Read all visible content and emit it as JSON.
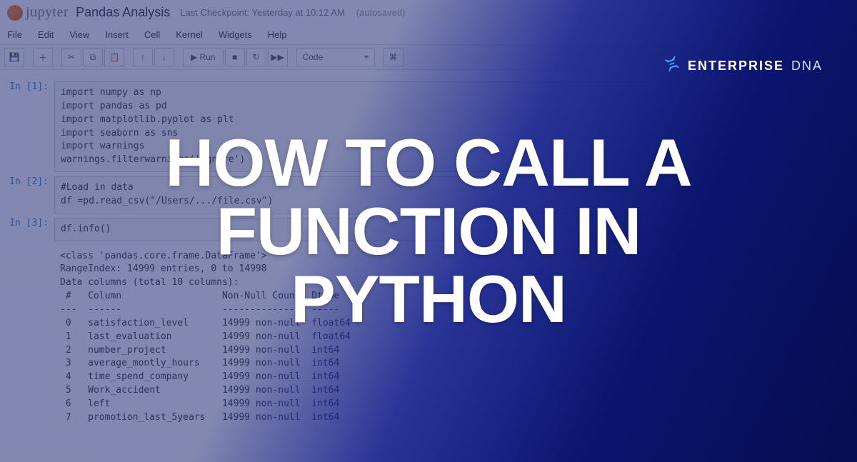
{
  "header": {
    "logo_text": "jupyter",
    "notebook_title": "Pandas Analysis",
    "checkpoint": "Last Checkpoint: Yesterday at 10:12 AM",
    "autosaved": "(autosaved)"
  },
  "menubar": [
    "File",
    "Edit",
    "View",
    "Insert",
    "Cell",
    "Kernel",
    "Widgets",
    "Help"
  ],
  "toolbar": {
    "save_icon": "💾",
    "add_icon": "＋",
    "cut_icon": "✂",
    "copy_icon": "⧉",
    "paste_icon": "📋",
    "up_icon": "↑",
    "down_icon": "↓",
    "run_label": "▶ Run",
    "stop_icon": "■",
    "restart_icon": "↻",
    "ff_icon": "▶▶",
    "celltype": "Code",
    "cmd_icon": "⌘"
  },
  "cells": {
    "in1_prompt": "In [1]:",
    "in1_code": "import numpy as np\nimport pandas as pd\nimport matplotlib.pyplot as plt\nimport seaborn as sns\nimport warnings\nwarnings.filterwarnings('ignore')",
    "in2_prompt": "In [2]:",
    "in2_code": "#Load in data\ndf =pd.read_csv(\"/Users/.../file.csv\")",
    "in3_prompt": "In [3]:",
    "in3_code": "df.info()",
    "out3": "<class 'pandas.core.frame.DataFrame'>\nRangeIndex: 14999 entries, 0 to 14998\nData columns (total 10 columns):\n #   Column                  Non-Null Count  Dtype  \n---  ------                  --------------  -----  \n 0   satisfaction_level      14999 non-null  float64\n 1   last_evaluation         14999 non-null  float64\n 2   number_project          14999 non-null  int64  \n 3   average_montly_hours    14999 non-null  int64  \n 4   time_spend_company      14999 non-null  int64  \n 5   Work_accident           14999 non-null  int64  \n 6   left                    14999 non-null  int64  \n 7   promotion_last_5years   14999 non-null  int64  "
  },
  "overlay": {
    "headline": "HOW TO CALL A\nFUNCTION IN\nPYTHON",
    "brand_strong": "ENTERPRISE",
    "brand_thin": "DNA"
  }
}
